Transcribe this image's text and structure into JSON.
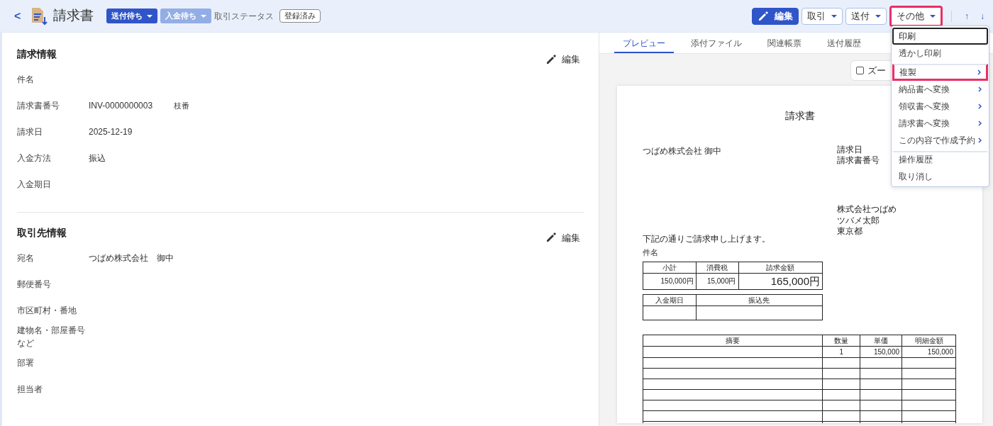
{
  "header": {
    "back_label": "<",
    "title": "請求書",
    "statuses": [
      {
        "label": "送付待ち",
        "color": "#2f55c8"
      },
      {
        "label": "入金待ち",
        "color": "#93aee6"
      }
    ],
    "status_caption": "取引ステータス",
    "registration_badge": "登録済み",
    "actions": [
      {
        "label": "編集",
        "kind": "primary",
        "highlighted": false
      },
      {
        "label": "取引",
        "kind": "dropdown",
        "highlighted": false
      },
      {
        "label": "送付",
        "kind": "dropdown",
        "highlighted": false
      },
      {
        "label": "その他",
        "kind": "dropdown",
        "highlighted": true
      }
    ],
    "nav_arrows": [
      "↑",
      "↓"
    ]
  },
  "menu": {
    "items": [
      {
        "label": "印刷",
        "submenu": false,
        "focused": true,
        "highlighted": false,
        "divider_before": false
      },
      {
        "label": "透かし印刷",
        "submenu": false,
        "focused": false,
        "highlighted": false,
        "divider_before": false
      },
      {
        "label": "複製",
        "submenu": true,
        "focused": false,
        "highlighted": true,
        "divider_before": true
      },
      {
        "label": "納品書へ変換",
        "submenu": true,
        "focused": false,
        "highlighted": false,
        "divider_before": false
      },
      {
        "label": "領収書へ変換",
        "submenu": true,
        "focused": false,
        "highlighted": false,
        "divider_before": false
      },
      {
        "label": "請求書へ変換",
        "submenu": true,
        "focused": false,
        "highlighted": false,
        "divider_before": false
      },
      {
        "label": "この内容で作成予約",
        "submenu": true,
        "focused": false,
        "highlighted": false,
        "divider_before": false
      },
      {
        "label": "操作履歴",
        "submenu": false,
        "focused": false,
        "highlighted": false,
        "divider_before": true
      },
      {
        "label": "取り消し",
        "submenu": false,
        "focused": false,
        "highlighted": false,
        "divider_before": false
      }
    ]
  },
  "sections": [
    {
      "title": "請求情報",
      "edit_label": "編集",
      "fields": [
        {
          "label": "件名"
        },
        {
          "label": "請求書番号",
          "value": "INV-0000000003",
          "extra": "枝番"
        },
        {
          "label": "請求日",
          "value": "2025-12-19"
        },
        {
          "label": "入金方法",
          "value": "振込"
        },
        {
          "label": "入金期日"
        }
      ]
    },
    {
      "title": "取引先情報",
      "edit_label": "編集",
      "fields": [
        {
          "label": "宛名",
          "value": "つばめ株式会社　御中"
        },
        {
          "label": "郵便番号"
        },
        {
          "label": "市区町村・番地"
        },
        {
          "label": "建物名・部屋番号など"
        },
        {
          "label": "部署"
        },
        {
          "label": "担当者"
        }
      ]
    }
  ],
  "preview": {
    "tabs": [
      {
        "label": "プレビュー",
        "selected": true
      },
      {
        "label": "添付ファイル",
        "selected": false
      },
      {
        "label": "関連帳票",
        "selected": false
      },
      {
        "label": "送付履歴",
        "selected": false
      }
    ],
    "zoom": {
      "label": "ズー",
      "checked": false
    },
    "document": {
      "title": "請求書",
      "recipient": "つばめ株式会社 御中",
      "meta_labels": [
        "請求日",
        "請求書番号"
      ],
      "issuer": {
        "name": "株式会社つばめ",
        "lines": [
          "ツバメ太郎",
          "東京都"
        ]
      },
      "greeting": "下記の通りご請求申し上げます。",
      "subject_label": "件名",
      "summary": {
        "columns": [
          "小計",
          "消費税",
          "請求金額"
        ],
        "values": [
          "150,000円",
          "15,000円",
          "165,000円"
        ]
      },
      "payment": {
        "columns": [
          "入金期日",
          "振込先"
        ]
      },
      "details": {
        "columns": [
          "摘要",
          "数量",
          "単価",
          "明細金額"
        ],
        "rows": [
          {
            "quantity": "1",
            "unit_price": "150,000",
            "amount": "150,000"
          }
        ]
      }
    }
  }
}
